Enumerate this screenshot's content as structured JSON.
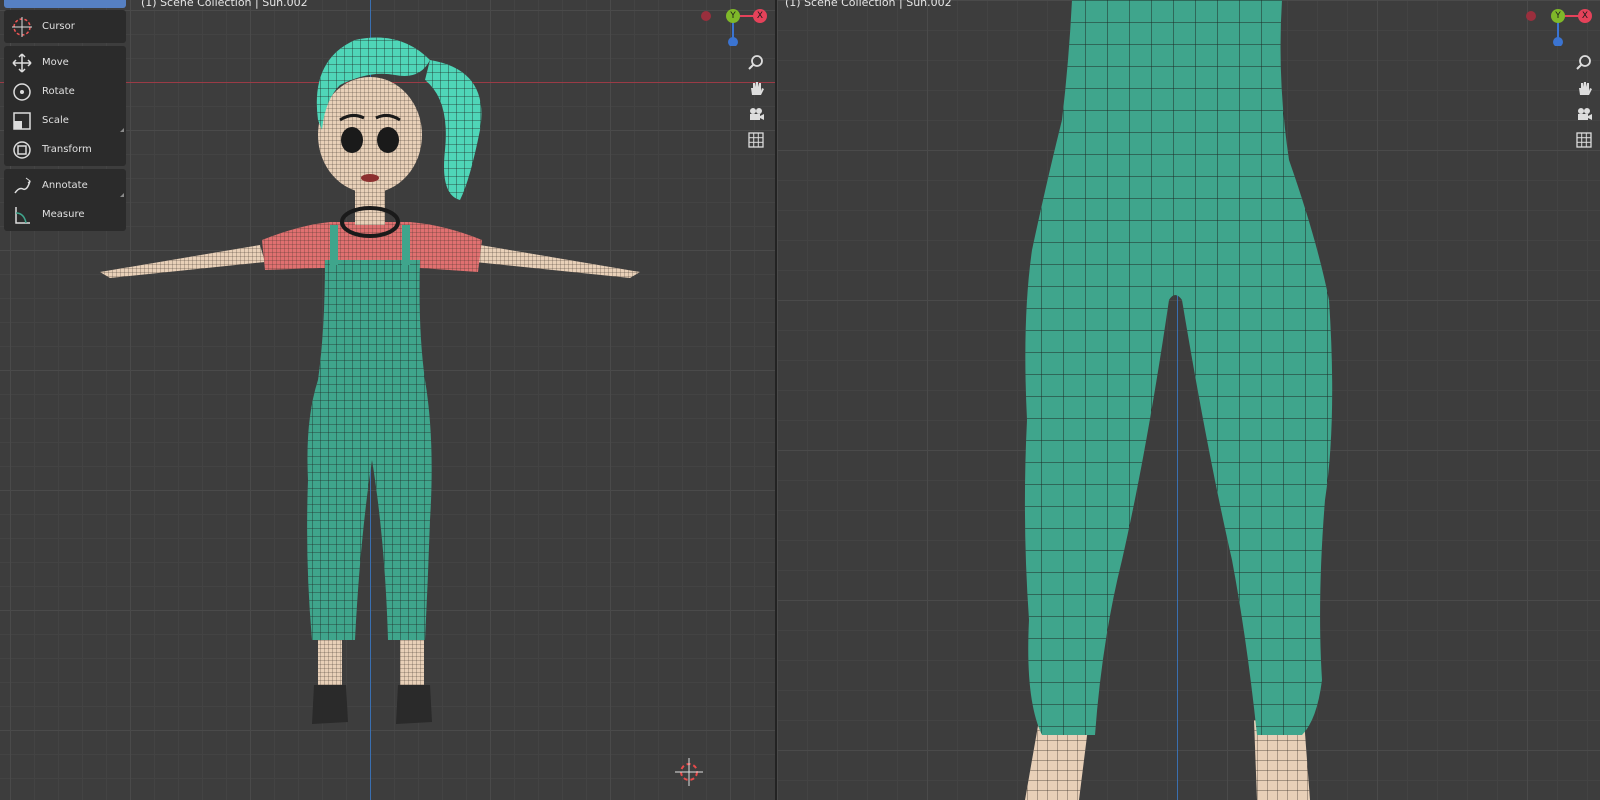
{
  "left_viewport": {
    "header": "(1) Scene Collection | Sun.002"
  },
  "right_viewport": {
    "header": "(1) Scene Collection | Sun.002"
  },
  "toolbar": {
    "groups": [
      [
        {
          "label": "Cursor",
          "icon": "cursor-icon"
        }
      ],
      [
        {
          "label": "Move",
          "icon": "move-icon"
        },
        {
          "label": "Rotate",
          "icon": "rotate-icon"
        },
        {
          "label": "Scale",
          "icon": "scale-icon"
        },
        {
          "label": "Transform",
          "icon": "transform-icon"
        }
      ],
      [
        {
          "label": "Annotate",
          "icon": "annotate-icon"
        },
        {
          "label": "Measure",
          "icon": "measure-icon"
        }
      ]
    ]
  },
  "gizmo": {
    "y_label": "Y",
    "x_label": "X",
    "colors": {
      "x": "#e5425a",
      "y": "#7fb829",
      "z": "#3b74d1",
      "x_neg": "#9a2f3d"
    }
  },
  "nav_icons": [
    "zoom-icon",
    "hand-pan-icon",
    "camera-icon",
    "grid-icon"
  ],
  "colors": {
    "overalls": "#3fa58c",
    "shirt": "#e07070",
    "skin": "#e8d0b8",
    "hair": "#4fd6b8",
    "shoes": "#2a2a2a"
  }
}
